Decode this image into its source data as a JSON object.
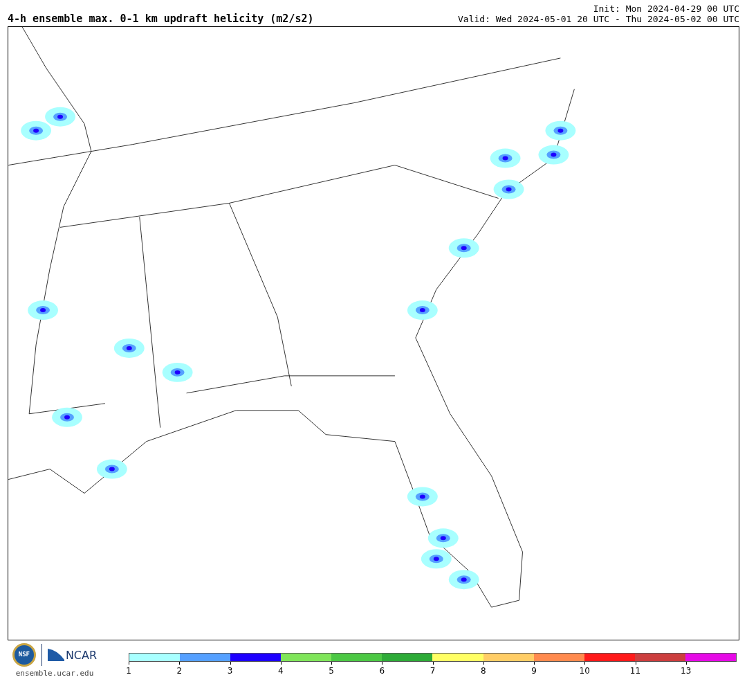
{
  "header": {
    "title": "4-h ensemble max. 0-1 km updraft helicity (m2/s2)",
    "init": "Init: Mon 2024-04-29 00 UTC",
    "valid": "Valid: Wed 2024-05-01 20 UTC - Thu 2024-05-02 00 UTC"
  },
  "footer": {
    "nsf_logo": "NSF",
    "ncar_logo": "NCAR",
    "url": "ensemble.ucar.edu"
  },
  "legend": {
    "segments": [
      {
        "label": "1",
        "color": "#a8ffff"
      },
      {
        "label": "2",
        "color": "#55a0ff"
      },
      {
        "label": "3",
        "color": "#1e00ff"
      },
      {
        "label": "4",
        "color": "#80e55a"
      },
      {
        "label": "5",
        "color": "#4cc844"
      },
      {
        "label": "6",
        "color": "#2eab38"
      },
      {
        "label": "7",
        "color": "#ffff64"
      },
      {
        "label": "8",
        "color": "#ffcd66"
      },
      {
        "label": "9",
        "color": "#ff8a4e"
      },
      {
        "label": "10",
        "color": "#ff1a1a"
      },
      {
        "label": "11",
        "color": "#cc3e3e"
      },
      {
        "label": "13",
        "color": "#e60ae6"
      }
    ]
  }
}
